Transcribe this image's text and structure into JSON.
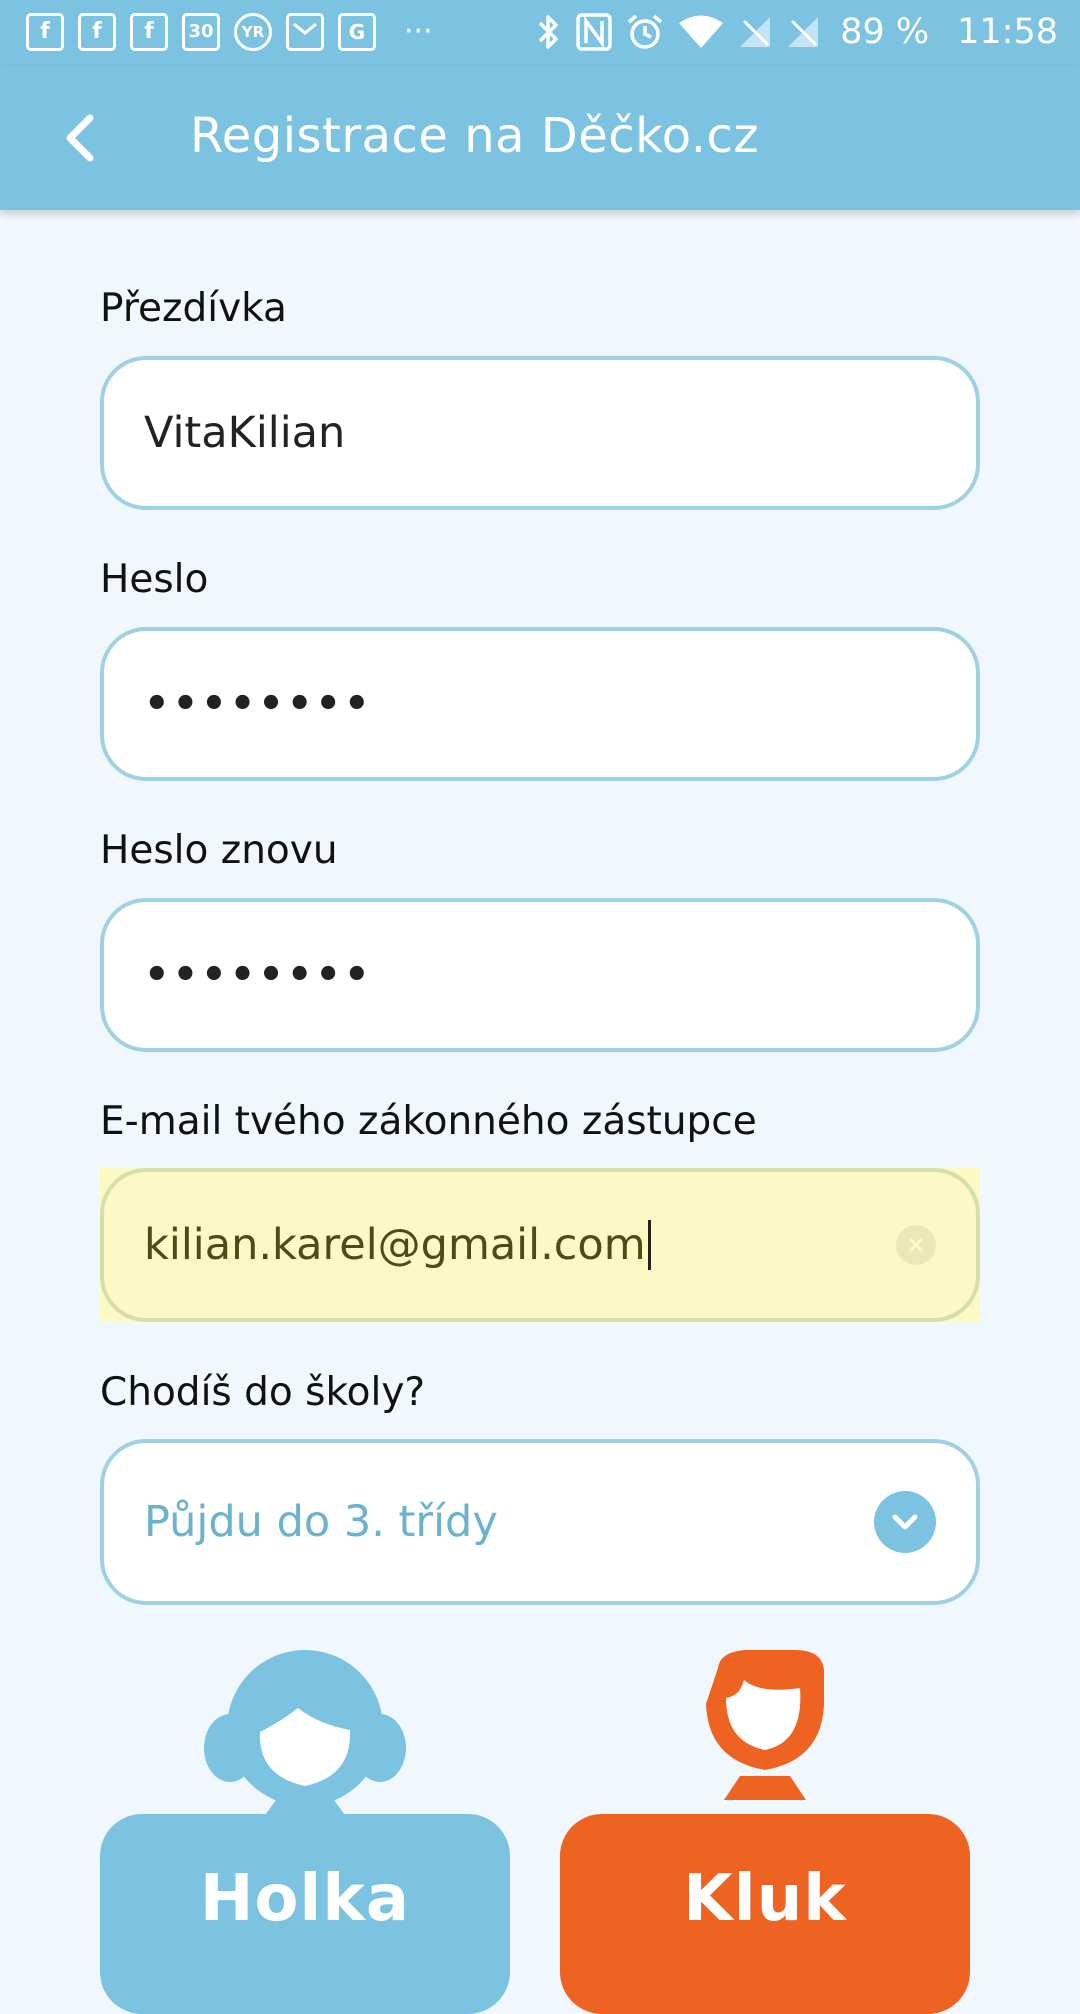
{
  "status_bar": {
    "notification_icons": [
      "facebook-icon",
      "facebook-icon",
      "facebook-icon",
      "calendar-icon",
      "yr-icon",
      "gmail-icon",
      "maps-icon",
      "more-icon"
    ],
    "calendar_day": "30",
    "yr_text": "YR",
    "more_text": "···",
    "battery_text": "89 %",
    "time": "11:58"
  },
  "app_bar": {
    "title": "Registrace na Děčko.cz"
  },
  "form": {
    "nickname": {
      "label": "Přezdívka",
      "value": "VitaKilian"
    },
    "password": {
      "label": "Heslo",
      "value": "••••••••"
    },
    "password_repeat": {
      "label": "Heslo znovu",
      "value": "••••••••"
    },
    "email": {
      "label": "E-mail tvého zákonného zástupce",
      "value": "kilian.karel@gmail.com"
    },
    "school": {
      "label": "Chodíš do školy?",
      "selected": "Půjdu do 3. třídy"
    }
  },
  "gender": {
    "girl_label": "Holka",
    "boy_label": "Kluk"
  },
  "colors": {
    "primary": "#7cc3e2",
    "accent": "#ef6322",
    "background": "#f0f8fd",
    "autofill": "#fdf9c4"
  }
}
